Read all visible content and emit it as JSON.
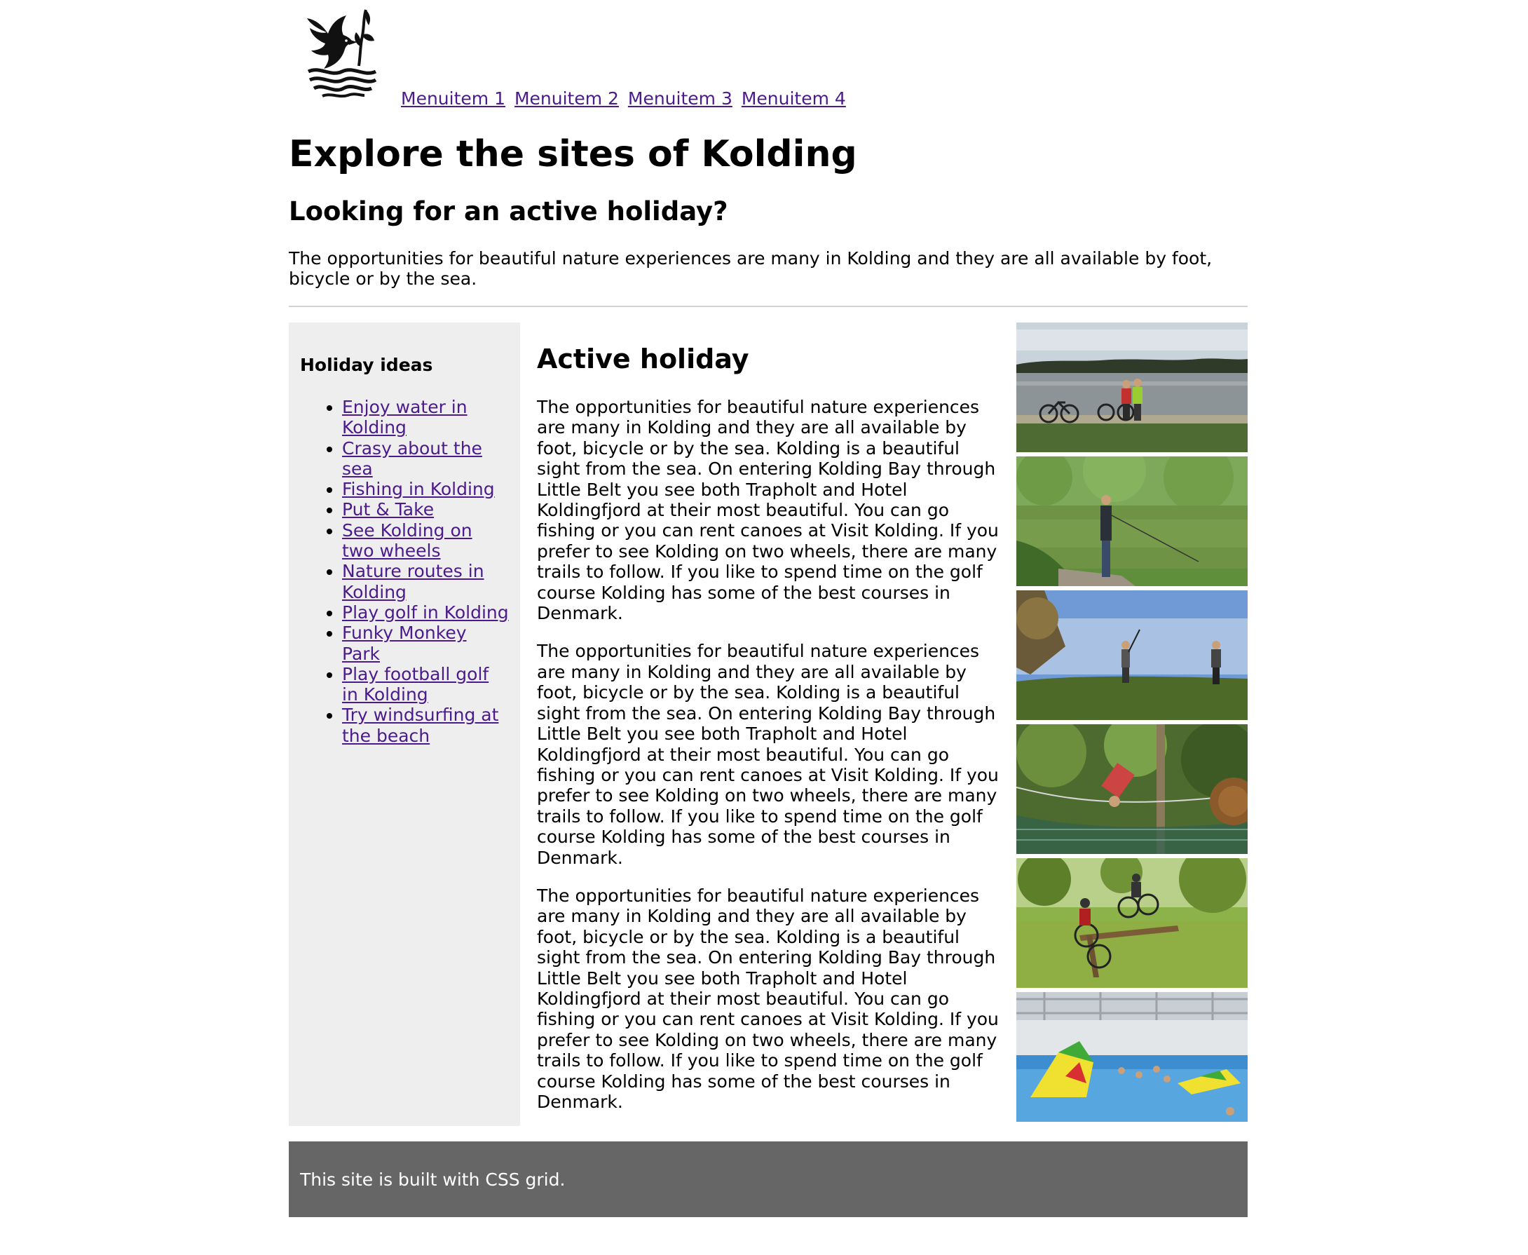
{
  "header": {
    "logo_icon": "kolding-bird-crest-logo",
    "menu": [
      {
        "label": "Menuitem 1"
      },
      {
        "label": "Menuitem 2"
      },
      {
        "label": "Menuitem 3"
      },
      {
        "label": "Menuitem 4"
      }
    ]
  },
  "intro": {
    "title": "Explore the sites of Kolding",
    "subtitle": "Looking for an active holiday?",
    "text": "The opportunities for beautiful nature experiences are many in Kolding and they are all available by foot, bicycle or by the sea."
  },
  "sidebar": {
    "heading": "Holiday ideas",
    "links": [
      {
        "label": "Enjoy water in Kolding"
      },
      {
        "label": "Crasy about the sea"
      },
      {
        "label": "Fishing in Kolding"
      },
      {
        "label": "Put & Take"
      },
      {
        "label": "See Kolding on two wheels"
      },
      {
        "label": "Nature routes in Kolding"
      },
      {
        "label": "Play golf in Kolding"
      },
      {
        "label": "Funky Monkey Park"
      },
      {
        "label": "Play football golf in Kolding"
      },
      {
        "label": "Try windsurfing at the beach"
      }
    ]
  },
  "main": {
    "heading": "Active holiday",
    "paragraphs": [
      "The opportunities for beautiful nature experiences are many in Kolding and they are all available by foot, bicycle or by the sea. Kolding is a beautiful sight from the sea. On entering Kolding Bay through Little Belt you see both Trapholt and Hotel Koldingfjord at their most beautiful. You can go fishing or you can rent canoes at Visit Kolding. If you prefer to see Kolding on two wheels, there are many trails to follow. If you like to spend time on the golf course Kolding has some of the best courses in Denmark.",
      "The opportunities for beautiful nature experiences are many in Kolding and they are all available by foot, bicycle or by the sea. Kolding is a beautiful sight from the sea. On entering Kolding Bay through Little Belt you see both Trapholt and Hotel Koldingfjord at their most beautiful. You can go fishing or you can rent canoes at Visit Kolding. If you prefer to see Kolding on two wheels, there are many trails to follow. If you like to spend time on the golf course Kolding has some of the best courses in Denmark.",
      "The opportunities for beautiful nature experiences are many in Kolding and they are all available by foot, bicycle or by the sea. Kolding is a beautiful sight from the sea. On entering Kolding Bay through Little Belt you see both Trapholt and Hotel Koldingfjord at their most beautiful. You can go fishing or you can rent canoes at Visit Kolding. If you prefer to see Kolding on two wheels, there are many trails to follow. If you like to spend time on the golf course Kolding has some of the best courses in Denmark."
    ]
  },
  "photos": [
    {
      "scene": "cyclists-by-lake"
    },
    {
      "scene": "fishing-by-river"
    },
    {
      "scene": "golfers-on-hill"
    },
    {
      "scene": "rope-course-park"
    },
    {
      "scene": "mountain-bikers"
    },
    {
      "scene": "indoor-water-park"
    }
  ],
  "footer": {
    "text": "This site is built with CSS grid."
  },
  "colors": {
    "link": "#4b1b8c",
    "sidebar_bg": "#eeeeee",
    "footer_bg": "#666666",
    "divider": "#d3d3d3"
  }
}
